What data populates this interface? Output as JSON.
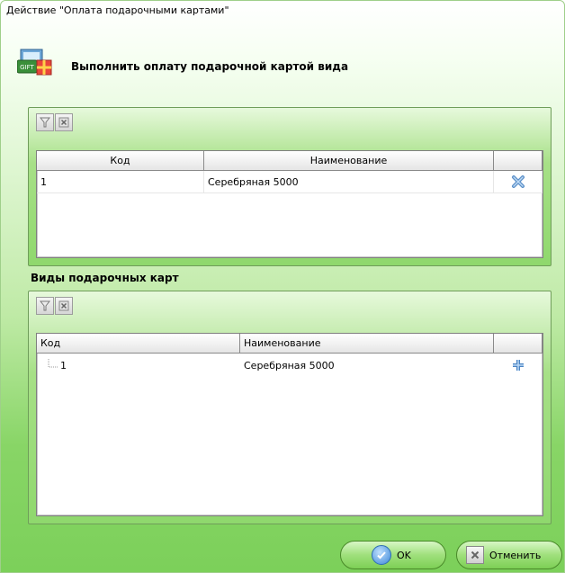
{
  "window": {
    "title": "Действие \"Оплата подарочными картами\""
  },
  "header": {
    "text": "Выполнить оплату подарочной картой вида",
    "icon": "gift-card-icon"
  },
  "selected_grid": {
    "columns": [
      "Код",
      "Наименование",
      ""
    ],
    "rows": [
      {
        "code": "1",
        "name": "Серебряная 5000",
        "action_icon": "remove-icon"
      }
    ]
  },
  "types_section": {
    "label": "Виды подарочных карт"
  },
  "types_grid": {
    "columns": [
      "Код",
      "Наименование",
      ""
    ],
    "rows": [
      {
        "code": "1",
        "name": "Серебряная 5000",
        "action_icon": "add-icon"
      }
    ]
  },
  "buttons": {
    "ok": "OK",
    "cancel": "Отменить"
  },
  "colors": {
    "accent_green": "#7cd05a",
    "panel_green": "#8fd86d",
    "ok_blue": "#3b86d6"
  }
}
